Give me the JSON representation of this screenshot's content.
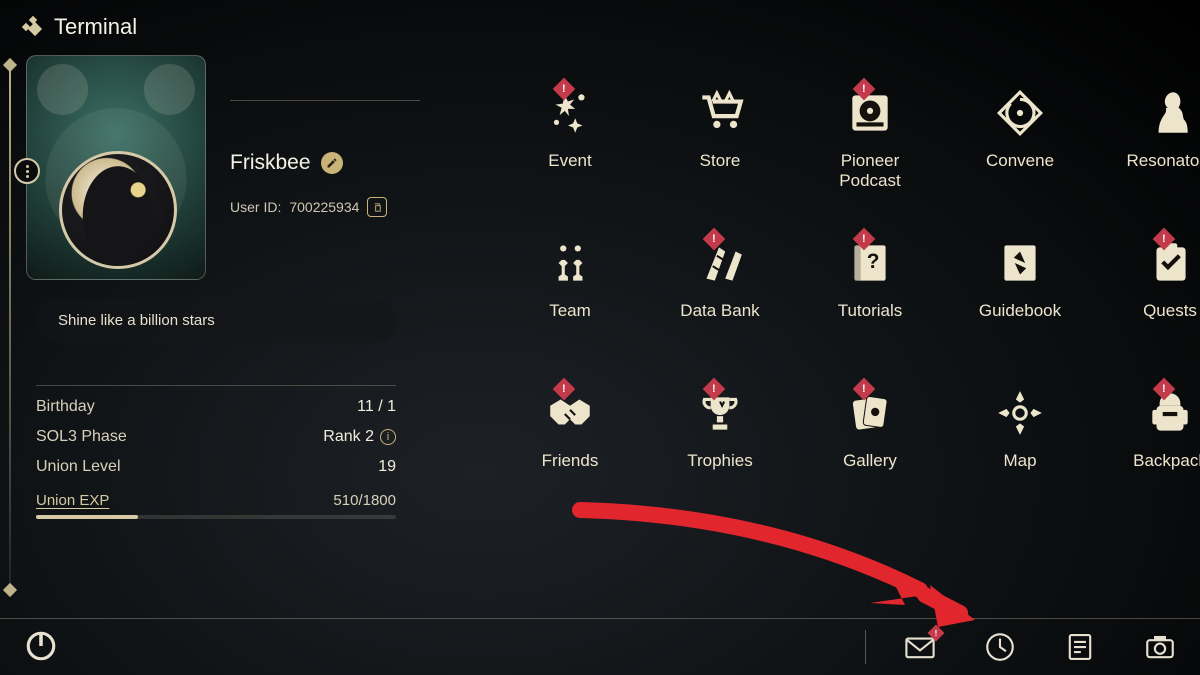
{
  "header": {
    "title": "Terminal"
  },
  "profile": {
    "name": "Friskbee",
    "user_id_label": "User ID:",
    "user_id": "700225934",
    "signature": "Shine like a billion stars"
  },
  "stats": {
    "birthday_label": "Birthday",
    "birthday_value": "11 / 1",
    "phase_label": "SOL3 Phase",
    "phase_value": "Rank 2",
    "level_label": "Union Level",
    "level_value": "19",
    "exp_label": "Union EXP",
    "exp_value": "510/1800",
    "exp_current": 510,
    "exp_max": 1800
  },
  "menu": [
    {
      "id": "event",
      "label": "Event",
      "icon": "sparkle",
      "alert": true
    },
    {
      "id": "store",
      "label": "Store",
      "icon": "cart",
      "alert": false
    },
    {
      "id": "pioneer-podcast",
      "label": "Pioneer\nPodcast",
      "icon": "record",
      "alert": true
    },
    {
      "id": "convene",
      "label": "Convene",
      "icon": "diamond-swirl",
      "alert": false
    },
    {
      "id": "resonators",
      "label": "Resonators",
      "icon": "silhouette",
      "alert": false
    },
    {
      "id": "team",
      "label": "Team",
      "icon": "chess",
      "alert": false
    },
    {
      "id": "data-bank",
      "label": "Data Bank",
      "icon": "databank",
      "alert": true
    },
    {
      "id": "tutorials",
      "label": "Tutorials",
      "icon": "book-q",
      "alert": true
    },
    {
      "id": "guidebook",
      "label": "Guidebook",
      "icon": "compass-book",
      "alert": false
    },
    {
      "id": "quests",
      "label": "Quests",
      "icon": "checklist",
      "alert": true
    },
    {
      "id": "friends",
      "label": "Friends",
      "icon": "handshake",
      "alert": true
    },
    {
      "id": "trophies",
      "label": "Trophies",
      "icon": "trophy",
      "alert": true
    },
    {
      "id": "gallery",
      "label": "Gallery",
      "icon": "cards",
      "alert": true
    },
    {
      "id": "map",
      "label": "Map",
      "icon": "compass",
      "alert": false
    },
    {
      "id": "backpack",
      "label": "Backpack",
      "icon": "backpack",
      "alert": true
    }
  ],
  "tray": [
    {
      "id": "mail",
      "icon": "mail",
      "alert": true
    },
    {
      "id": "time",
      "icon": "clock",
      "alert": false
    },
    {
      "id": "notice",
      "icon": "note",
      "alert": false
    },
    {
      "id": "camera",
      "icon": "camera",
      "alert": false
    }
  ]
}
